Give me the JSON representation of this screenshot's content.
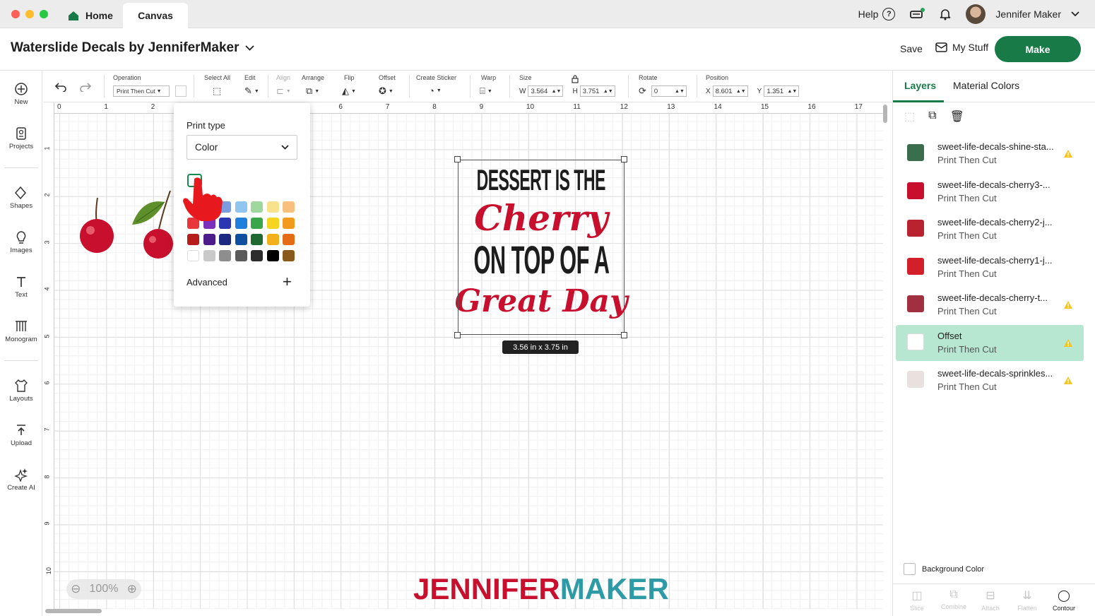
{
  "tabs": {
    "home": "Home",
    "canvas": "Canvas"
  },
  "topbar": {
    "help": "Help",
    "user": "Jennifer Maker"
  },
  "header": {
    "title": "Waterslide Decals by JenniferMaker",
    "save": "Save",
    "my_stuff": "My Stuff",
    "make": "Make"
  },
  "sidebar": {
    "items": [
      {
        "label": "New",
        "icon": "plus-circle-icon"
      },
      {
        "label": "Projects",
        "icon": "projects-icon"
      },
      {
        "label": "Shapes",
        "icon": "shapes-icon"
      },
      {
        "label": "Images",
        "icon": "bulb-icon"
      },
      {
        "label": "Text",
        "icon": "text-icon"
      },
      {
        "label": "Monogram",
        "icon": "monogram-icon"
      },
      {
        "label": "Layouts",
        "icon": "tshirt-icon"
      },
      {
        "label": "Upload",
        "icon": "upload-icon"
      },
      {
        "label": "Create AI",
        "icon": "sparkle-icon"
      }
    ]
  },
  "toolbar": {
    "operation_label": "Operation",
    "operation_value": "Print Then Cut",
    "select_all": "Select All",
    "edit": "Edit",
    "align": "Align",
    "arrange": "Arrange",
    "flip": "Flip",
    "offset": "Offset",
    "create_sticker": "Create Sticker",
    "warp": "Warp",
    "size": "Size",
    "w_label": "W",
    "w_value": "3.564",
    "h_label": "H",
    "h_value": "3.751",
    "rotate": "Rotate",
    "rotate_value": "0",
    "position": "Position",
    "x_label": "X",
    "x_value": "8.601",
    "y_label": "Y",
    "y_value": "1.351"
  },
  "ruler": {
    "top": [
      "0",
      "1",
      "2",
      "3",
      "4",
      "5",
      "6",
      "7",
      "8",
      "9",
      "10",
      "11",
      "12",
      "13",
      "14",
      "15",
      "16",
      "17"
    ],
    "left": [
      "1",
      "2",
      "3",
      "4",
      "5",
      "6",
      "7",
      "8",
      "9",
      "10"
    ]
  },
  "popup": {
    "title": "Print type",
    "select_value": "Color",
    "advanced": "Advanced",
    "swatch_rows": [
      [
        "#ffffff",
        "#a8a6dd",
        "#7d9ce0",
        "#8fc6f0",
        "#9fd79f",
        "#f8e38c",
        "#f8c07c"
      ],
      [
        "#e8363b",
        "#7b2fbd",
        "#2a37b0",
        "#1e7fdc",
        "#3aa54a",
        "#f6d522",
        "#f39a1d"
      ],
      [
        "#b71c1c",
        "#4c1d8a",
        "#1b2a80",
        "#0e4fa0",
        "#1f6a30",
        "#f2b01a",
        "#e56b15"
      ],
      [
        "#ffffff",
        "#c9c9c9",
        "#8e8e8e",
        "#5b5b5b",
        "#2c2c2c",
        "#000000",
        "#8a5a1c"
      ]
    ]
  },
  "design": {
    "line1": "DESSERT IS THE",
    "line2": "Cherry",
    "line3": "ON TOP OF A",
    "line4": "Great Day",
    "dimensions": "3.56  in x 3.75  in"
  },
  "canvas": {
    "zoom": "100%"
  },
  "watermark": {
    "part1": "JENNIFER",
    "part2": "MAKER"
  },
  "rpanel": {
    "tab_layers": "Layers",
    "tab_material": "Material Colors",
    "layers": [
      {
        "name": "sweet-life-decals-shine-sta...",
        "op": "Print Then Cut",
        "warn": true,
        "active": false,
        "thumb": "#3a6e4f"
      },
      {
        "name": "sweet-life-decals-cherry3-...",
        "op": "Print Then Cut",
        "warn": false,
        "active": false,
        "thumb": "#c8102e"
      },
      {
        "name": "sweet-life-decals-cherry2-j...",
        "op": "Print Then Cut",
        "warn": false,
        "active": false,
        "thumb": "#b8232f"
      },
      {
        "name": "sweet-life-decals-cherry1-j...",
        "op": "Print Then Cut",
        "warn": false,
        "active": false,
        "thumb": "#d21f2a"
      },
      {
        "name": "sweet-life-decals-cherry-t...",
        "op": "Print Then Cut",
        "warn": true,
        "active": false,
        "thumb": "#a03040"
      },
      {
        "name": "Offset",
        "op": "Print Then Cut",
        "warn": true,
        "active": true,
        "thumb": "#ffffff"
      },
      {
        "name": "sweet-life-decals-sprinkles...",
        "op": "Print Then Cut",
        "warn": true,
        "active": false,
        "thumb": "#e9e0e0"
      }
    ],
    "background_color": "Background Color",
    "bottom": [
      "Slice",
      "Combine",
      "Attach",
      "Flatten",
      "Contour"
    ]
  },
  "colors": {
    "accent": "#187a47",
    "brand_red": "#c8102e",
    "active_layer": "#b7e6d1"
  }
}
